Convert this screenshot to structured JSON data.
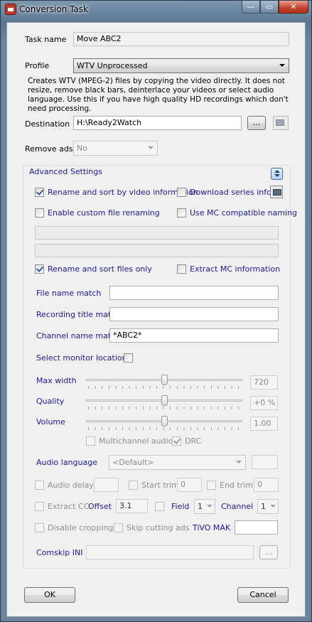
{
  "window": {
    "title": "Conversion Task",
    "buttons": {
      "minimize": "—",
      "maximize": "▭",
      "close": "✕"
    }
  },
  "task_name": {
    "label": "Task name",
    "value": "Move ABC2"
  },
  "profile": {
    "label": "Profile",
    "value": "WTV Unprocessed",
    "description": "Creates WTV (MPEG-2) files by copying the video directly. It does not resize, remove black bars, deinterlace your videos or select audio language. Use this if you have high quality HD recordings which don't need processing."
  },
  "destination": {
    "label": "Destination",
    "value": "H:\\Ready2Watch",
    "browse_label": "..."
  },
  "remove_ads": {
    "label": "Remove ads",
    "value": "No"
  },
  "advanced": {
    "title": "Advanced Settings",
    "rename_sort_video_info": {
      "label": "Rename and sort by video information",
      "checked": true
    },
    "download_series_info": {
      "label": "Download series info",
      "checked": false
    },
    "custom_file_renaming": {
      "label": "Enable custom file renaming",
      "checked": false
    },
    "mc_compatible_naming": {
      "label": "Use MC compatible naming",
      "checked": false
    },
    "rename_sort_files_only": {
      "label": "Rename and sort files only",
      "checked": true
    },
    "extract_mc_information": {
      "label": "Extract MC information",
      "checked": false
    },
    "file_name_match": {
      "label": "File name match",
      "value": ""
    },
    "recording_title_match": {
      "label": "Recording title match",
      "value": ""
    },
    "channel_name_match": {
      "label": "Channel name match",
      "value": "*ABC2*"
    },
    "select_monitor_locations": {
      "label": "Select monitor locations",
      "checked": false
    },
    "max_width": {
      "label": "Max width",
      "value": "720",
      "level": 0.5
    },
    "quality": {
      "label": "Quality",
      "value": "+0 %",
      "level": 0.5
    },
    "volume": {
      "label": "Volume",
      "value": "1.00",
      "level": 0.5
    },
    "multichannel_audio": {
      "label": "Multichannel audio",
      "checked": false
    },
    "drc": {
      "label": "DRC",
      "checked": true
    },
    "audio_language": {
      "label": "Audio language",
      "value": "<Default>",
      "extra": ""
    },
    "audio_delay": {
      "label": "Audio delay",
      "value": ""
    },
    "start_trim": {
      "label": "Start trim",
      "value": "0"
    },
    "end_trim": {
      "label": "End trim",
      "value": "0"
    },
    "extract_cc": {
      "label": "Extract CC"
    },
    "offset": {
      "label": "Offset",
      "value": "3.1"
    },
    "field": {
      "label": "Field",
      "value": "1"
    },
    "channel": {
      "label": "Channel",
      "value": "1"
    },
    "disable_cropping": {
      "label": "Disable cropping"
    },
    "skip_cutting_ads": {
      "label": "Skip cutting ads"
    },
    "tivo_mak": {
      "label": "TiVO MAK",
      "value": ""
    },
    "comskip_ini": {
      "label": "Comskip INI",
      "value": "",
      "browse_label": "..."
    }
  },
  "footer": {
    "ok_label": "OK",
    "cancel_label": "Cancel"
  }
}
